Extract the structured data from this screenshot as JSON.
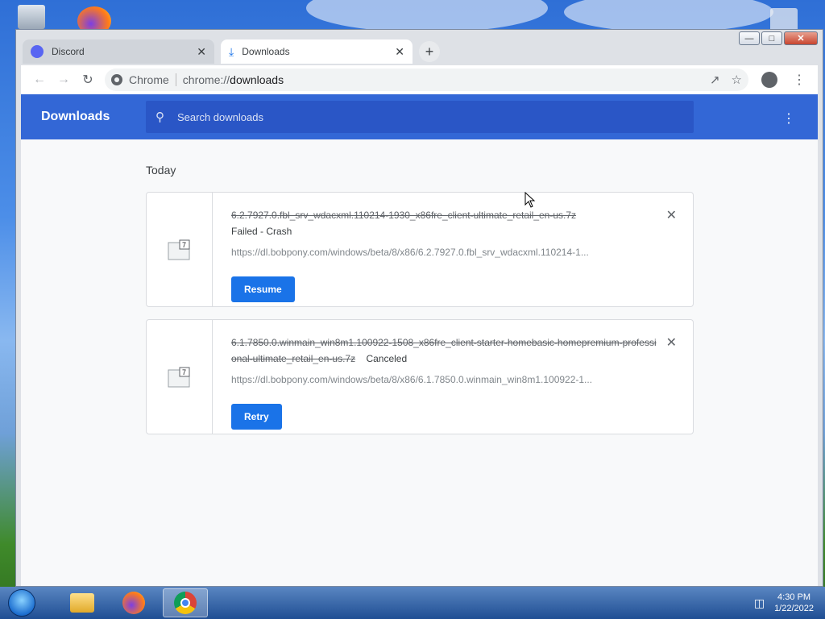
{
  "tabs": [
    {
      "label": "Discord",
      "icon": "discord-icon"
    },
    {
      "label": "Downloads",
      "icon": "download-icon",
      "active": true
    }
  ],
  "toolbar": {
    "site_label": "Chrome",
    "url_scheme": "chrome://",
    "url_path": "downloads"
  },
  "downloads": {
    "title": "Downloads",
    "search_placeholder": "Search downloads",
    "section_label": "Today",
    "items": [
      {
        "filename": "6.2.7927.0.fbl_srv_wdacxml.110214-1930_x86fre_client-ultimate_retail_en-us.7z",
        "status": "Failed - Crash",
        "url": "https://dl.bobpony.com/windows/beta/8/x86/6.2.7927.0.fbl_srv_wdacxml.110214-1...",
        "action": "Resume"
      },
      {
        "filename": "6.1.7850.0.winmain_win8m1.100922-1508_x86fre_client-starter-homebasic-homepremium-professional-ultimate_retail_en-us.7z",
        "status": "Canceled",
        "url": "https://dl.bobpony.com/windows/beta/8/x86/6.1.7850.0.winmain_win8m1.100922-1...",
        "action": "Retry"
      }
    ]
  },
  "taskbar": {
    "time": "4:30 PM",
    "date": "1/22/2022"
  },
  "colors": {
    "header_blue": "#3367d6",
    "button_blue": "#1a73e8"
  }
}
